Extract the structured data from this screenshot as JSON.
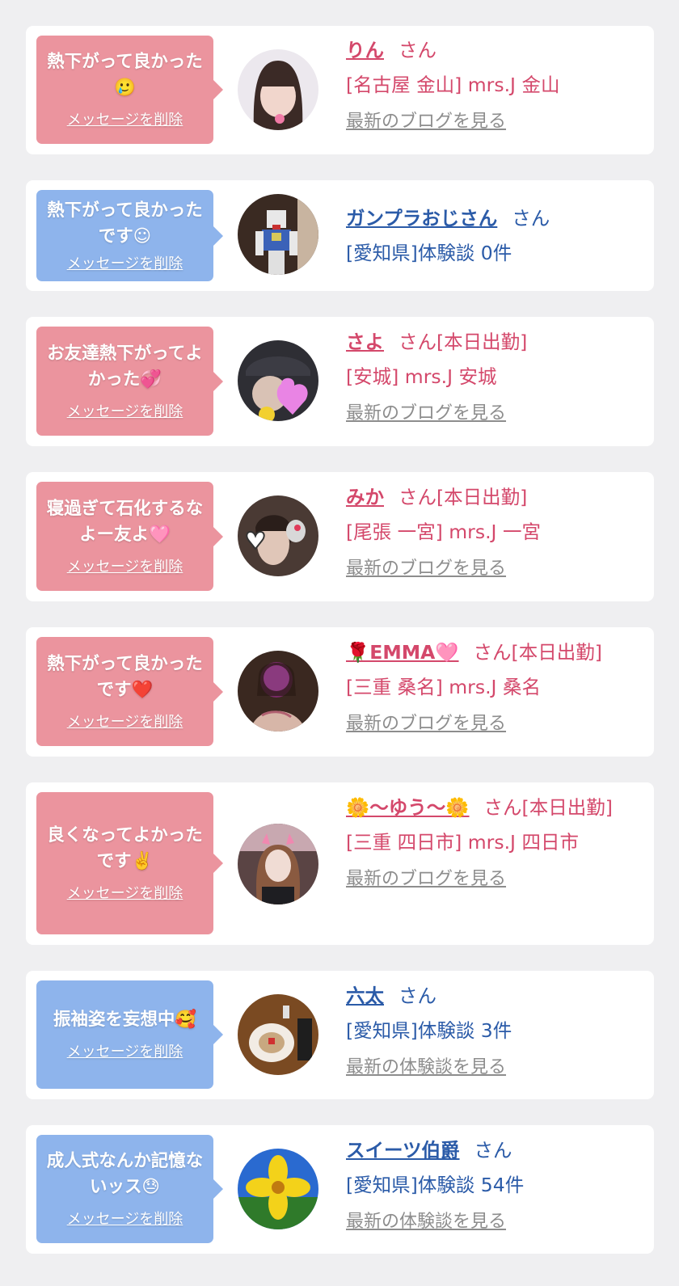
{
  "delete_label": "メッセージを削除",
  "colors": {
    "pink": "#eb949e",
    "blue": "#8eb4ec",
    "pink_text": "#d4486b",
    "blue_text": "#2b5ba8",
    "link_gray": "#8d8d8d",
    "background": "#efeff1"
  },
  "cards": [
    {
      "msg": "熱下がって良かった🥲",
      "name": "りん",
      "suffix": "さん",
      "detail": "[名古屋 金山] mrs.J 金山",
      "link": "最新のブログを見る",
      "theme": "pink"
    },
    {
      "msg": "熱下がって良かったです☺",
      "name": "ガンプラおじさん",
      "suffix": "さん",
      "detail": "[愛知県]体験談 0件",
      "link": "",
      "theme": "blue"
    },
    {
      "msg": "お友達熱下がってよかった💞",
      "name": "さよ",
      "suffix": "さん[本日出勤]",
      "detail": "[安城] mrs.J 安城",
      "link": "最新のブログを見る",
      "theme": "pink"
    },
    {
      "msg": "寝過ぎて石化するなよー友よ🩷",
      "name": "みか",
      "suffix": "さん[本日出勤]",
      "detail": "[尾張 一宮] mrs.J 一宮",
      "link": "最新のブログを見る",
      "theme": "pink"
    },
    {
      "msg": "熱下がって良かったです❤️",
      "name": "🌹EMMA🩷",
      "suffix": "さん[本日出勤]",
      "detail": "[三重 桑名] mrs.J 桑名",
      "link": "最新のブログを見る",
      "theme": "pink"
    },
    {
      "msg": "良くなってよかったです✌️",
      "name": "🌼〜ゆう〜🌼",
      "suffix": "さん[本日出勤]",
      "detail": "[三重 四日市] mrs.J 四日市",
      "link": "最新のブログを見る",
      "theme": "pink"
    },
    {
      "msg": "振袖姿を妄想中🥰",
      "name": "六太",
      "suffix": "さん",
      "detail": "[愛知県]体験談 3件",
      "link": "最新の体験談を見る",
      "theme": "blue"
    },
    {
      "msg": "成人式なんか記憶ないッス😓",
      "name": "スイーツ伯爵",
      "suffix": "さん",
      "detail": "[愛知県]体験談 54件",
      "link": "最新の体験談を見る",
      "theme": "blue"
    }
  ]
}
